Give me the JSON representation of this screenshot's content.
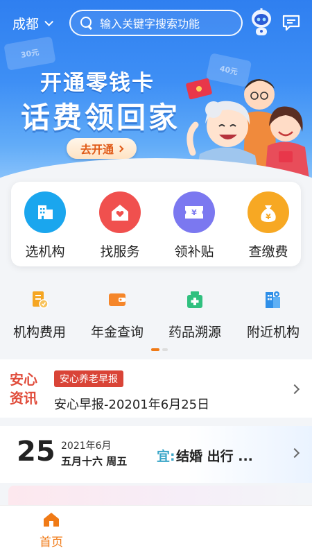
{
  "header": {
    "city": "成都",
    "search_placeholder": "输入关键字搜索功能"
  },
  "banner": {
    "ticket_left": "30元",
    "ticket_right": "40元",
    "title_line1": "开通零钱卡",
    "title_line2": "话费领回家",
    "cta_label": "去开通"
  },
  "main_services": [
    {
      "label": "选机构",
      "icon": "building-icon",
      "color": "#1aa6ee"
    },
    {
      "label": "找服务",
      "icon": "house-heart-icon",
      "color": "#f0504e"
    },
    {
      "label": "领补贴",
      "icon": "yuan-ticket-icon",
      "color": "#7b78f0"
    },
    {
      "label": "查缴费",
      "icon": "money-bag-icon",
      "color": "#f7a823"
    }
  ],
  "secondary_services": [
    {
      "label": "机构费用",
      "icon": "fee-document-icon",
      "color": "#f5a623"
    },
    {
      "label": "年金查询",
      "icon": "wallet-icon",
      "color": "#f5862a"
    },
    {
      "label": "药品溯源",
      "icon": "medicine-box-icon",
      "color": "#30c07f"
    },
    {
      "label": "附近机构",
      "icon": "nearby-building-icon",
      "color": "#2f8fe8"
    }
  ],
  "news": {
    "brand_line1": "安心",
    "brand_line2": "资讯",
    "tag": "安心养老早报",
    "headline": "安心早报-20201年6月25日"
  },
  "calendar": {
    "day": "25",
    "year_month": "2021年6月",
    "lunar": "五月十六  周五",
    "yi_label": "宜:",
    "yi_value": "结婚 出行 ..."
  },
  "bottom_nav": {
    "home_label": "首页"
  },
  "colors": {
    "primary_blue": "#2f7ff0",
    "accent_orange": "#f07a16",
    "news_red": "#d94437"
  }
}
